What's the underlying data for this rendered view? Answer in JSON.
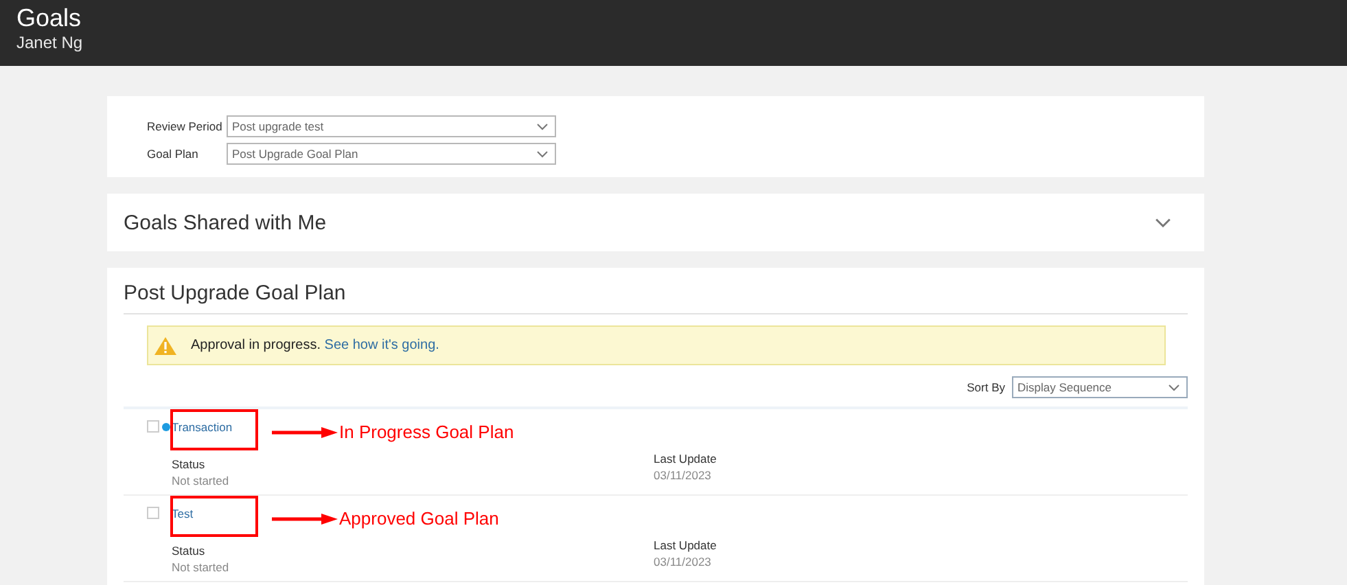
{
  "header": {
    "title": "Goals",
    "subtitle": "Janet Ng"
  },
  "filters": [
    {
      "label": "Review Period",
      "value": "Post upgrade test"
    },
    {
      "label": "Goal Plan",
      "value": "Post Upgrade Goal Plan"
    }
  ],
  "shared_section": {
    "title": "Goals Shared with Me",
    "expanded": false
  },
  "plan": {
    "title": "Post Upgrade Goal Plan",
    "alert": {
      "message": "Approval in progress.",
      "link": "See how it's going."
    },
    "sort": {
      "label": "Sort By",
      "value": "Display Sequence"
    },
    "goals": [
      {
        "name": "Transaction",
        "checked": false,
        "indicator": true,
        "status_label": "Status",
        "status": "Not started",
        "update_label": "Last Update",
        "update": "03/11/2023",
        "annotation": "In Progress Goal Plan"
      },
      {
        "name": "Test",
        "checked": false,
        "indicator": false,
        "status_label": "Status",
        "status": "Not started",
        "update_label": "Last Update",
        "update": "03/11/2023",
        "annotation": "Approved Goal Plan"
      }
    ]
  }
}
